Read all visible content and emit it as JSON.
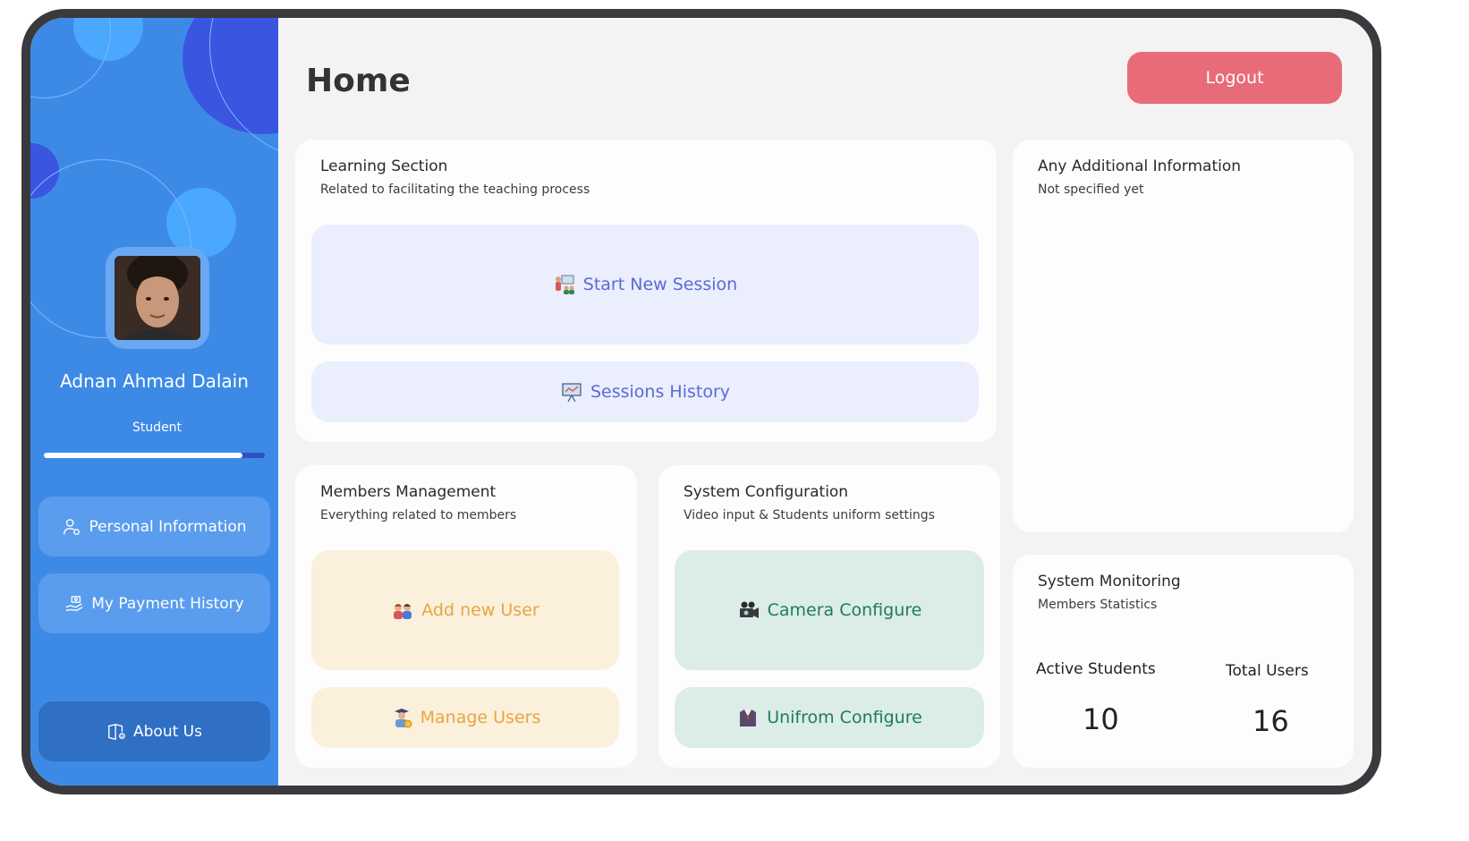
{
  "header": {
    "title": "Home",
    "logout_label": "Logout"
  },
  "user": {
    "name": "Adnan Ahmad Dalain",
    "role": "Student",
    "progress": 0.9
  },
  "sidebar": {
    "items": [
      {
        "label": "Personal Information",
        "icon": "user-gear-icon"
      },
      {
        "label": "My Payment History",
        "icon": "hand-money-icon"
      }
    ],
    "about_label": "About Us",
    "about_icon": "book-info-icon"
  },
  "learning": {
    "title": "Learning Section",
    "subtitle": "Related to facilitating the teaching process",
    "start_label": "Start New Session",
    "history_label": "Sessions History"
  },
  "members": {
    "title": "Members Management",
    "subtitle": "Everything related to members",
    "add_label": "Add new User",
    "manage_label": "Manage Users"
  },
  "config": {
    "title": "System Configuration",
    "subtitle": "Video input & Students uniform settings",
    "camera_label": "Camera Configure",
    "uniform_label": "Unifrom Configure"
  },
  "additional": {
    "title": "Any Additional Information",
    "subtitle": "Not specified yet"
  },
  "monitoring": {
    "title": "System Monitoring",
    "subtitle": "Members Statistics",
    "active_label": "Active Students",
    "active_value": "10",
    "total_label": "Total Users",
    "total_value": "16"
  },
  "colors": {
    "sidebar": "#3d8ae6",
    "logout": "#e76b78",
    "blue_action": "#ebeefc",
    "peach_action": "#fbf0dc",
    "teal_action": "#dcece8"
  }
}
